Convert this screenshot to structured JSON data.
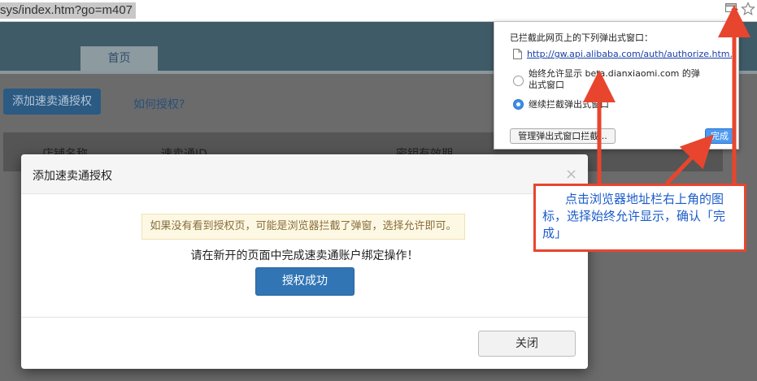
{
  "browser": {
    "url": "sys/index.htm?go=m407"
  },
  "page": {
    "tabs": [
      {
        "label": "首页"
      }
    ],
    "add_button_label": "添加速卖通授权",
    "how_link_label": "如何授权?",
    "table_headers": [
      "店铺名称",
      "速卖通ID",
      "密钥有效期"
    ]
  },
  "modal": {
    "title": "添加速卖通授权",
    "close_glyph": "×",
    "warning_text": "如果没有看到授权页，可能是浏览器拦截了弹窗，选择允许即可。",
    "instruction": "请在新开的页面中完成速卖通账户绑定操作！",
    "success_button_label": "授权成功",
    "close_button_label": "关闭"
  },
  "popup_bubble": {
    "title": "已拦截此网页上的下列弹出式窗口：",
    "blocked_link": "http://gw.api.alibaba.com/auth/authorize.htm...",
    "options": [
      {
        "line1": "始终允许显示 beta.dianxiaomi.com 的弹",
        "line2": "出式窗口",
        "checked": false
      },
      {
        "line1": "继续拦截弹出式窗口",
        "line2": "",
        "checked": true
      }
    ],
    "manage_button_label": "管理弹出式窗口拦截...",
    "done_button_label": "完成"
  },
  "annotation": {
    "text": "点击浏览器地址栏右上角的图标，选择始终允许显示，确认「完成」",
    "color": "#e8452e"
  },
  "colors": {
    "accent_blue": "#3175b5",
    "warning_bg": "#fcf8e3",
    "arrow_red": "#e8452e"
  },
  "icons": [
    "popup-blocked-icon",
    "bookmark-star-icon",
    "document-icon",
    "close-icon"
  ]
}
